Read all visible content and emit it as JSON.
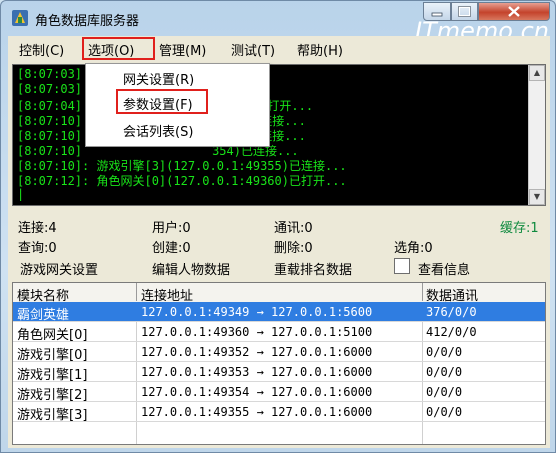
{
  "window": {
    "title": "角色数据库服务器"
  },
  "watermark": "ITmemo.cn",
  "menu": {
    "items": [
      "控制(C)",
      "选项(O)",
      "管理(M)",
      "测试(T)",
      "帮助(H)"
    ]
  },
  "options_menu": {
    "items": [
      "网关设置(R)",
      "参数设置(F)",
      "会话列表(S)"
    ]
  },
  "console": {
    "lines": [
      "[8:07:03]",
      "[8:07:03]",
      "[8:07:04]                  49349)已打开...",
      "[8:07:10]                  3352)已连接...",
      "[8:07:10]                  3353)已连接...",
      "[8:07:10]                  354)已连接...",
      "[8:07:10]: 游戏引擎[3](127.0.0.1:49355)已连接...",
      "[8:07:12]: 角色网关[0](127.0.0.1:49360)已打开...",
      "|"
    ]
  },
  "stats": {
    "connect": "连接:4",
    "users": "用户:0",
    "comm": "通讯:0",
    "cache": "缓存:1",
    "query": "查询:0",
    "create": "创建:0",
    "delete": "删除:0",
    "select": "选角:0",
    "btn_gateway": "游戏网关设置",
    "btn_edit": "编辑人物数据",
    "btn_reload": "重载排名数据",
    "view_info": "查看信息"
  },
  "table": {
    "headers": [
      "模块名称",
      "连接地址",
      "数据通讯"
    ],
    "rows": [
      {
        "name": "霸剑英雄",
        "addr": "127.0.0.1:49349 → 127.0.0.1:5600",
        "data": "376/0/0"
      },
      {
        "name": "角色网关[0]",
        "addr": "127.0.0.1:49360 → 127.0.0.1:5100",
        "data": "412/0/0"
      },
      {
        "name": "游戏引擎[0]",
        "addr": "127.0.0.1:49352 → 127.0.0.1:6000",
        "data": "0/0/0"
      },
      {
        "name": "游戏引擎[1]",
        "addr": "127.0.0.1:49353 → 127.0.0.1:6000",
        "data": "0/0/0"
      },
      {
        "name": "游戏引擎[2]",
        "addr": "127.0.0.1:49354 → 127.0.0.1:6000",
        "data": "0/0/0"
      },
      {
        "name": "游戏引擎[3]",
        "addr": "127.0.0.1:49355 → 127.0.0.1:6000",
        "data": "0/0/0"
      }
    ]
  }
}
